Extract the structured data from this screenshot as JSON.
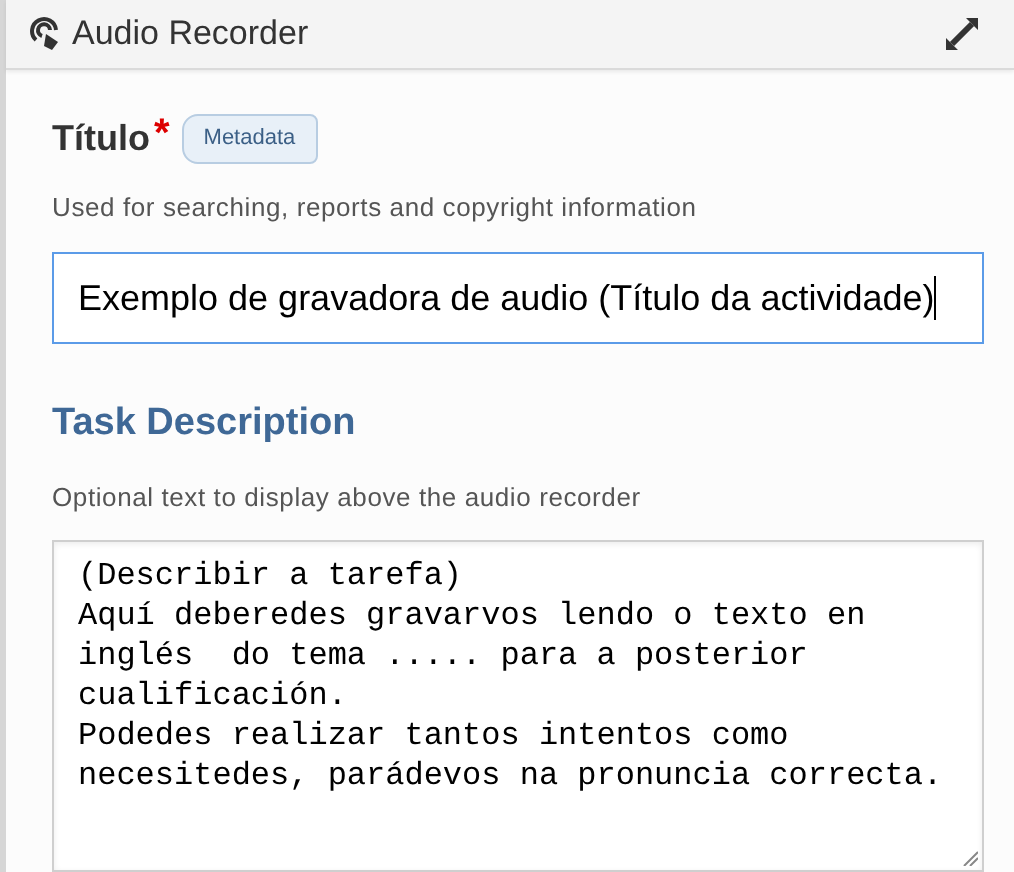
{
  "header": {
    "title": "Audio Recorder"
  },
  "title_field": {
    "label": "Título",
    "required_mark": "*",
    "badge": "Metadata",
    "description": "Used for searching, reports and copyright information",
    "value": "Exemplo de gravadora de audio (Título da actividade)",
    "focused": true
  },
  "task_field": {
    "label": "Task Description",
    "description": "Optional text to display above the audio recorder",
    "value": "(Describir a tarefa)\nAquí deberedes gravarvos lendo o texto en\ninglés  do tema ..... para a posterior\ncualificación.\nPodedes realizar tantos intentos como\nnecesitedes, parádevos na pronuncia correcta."
  }
}
